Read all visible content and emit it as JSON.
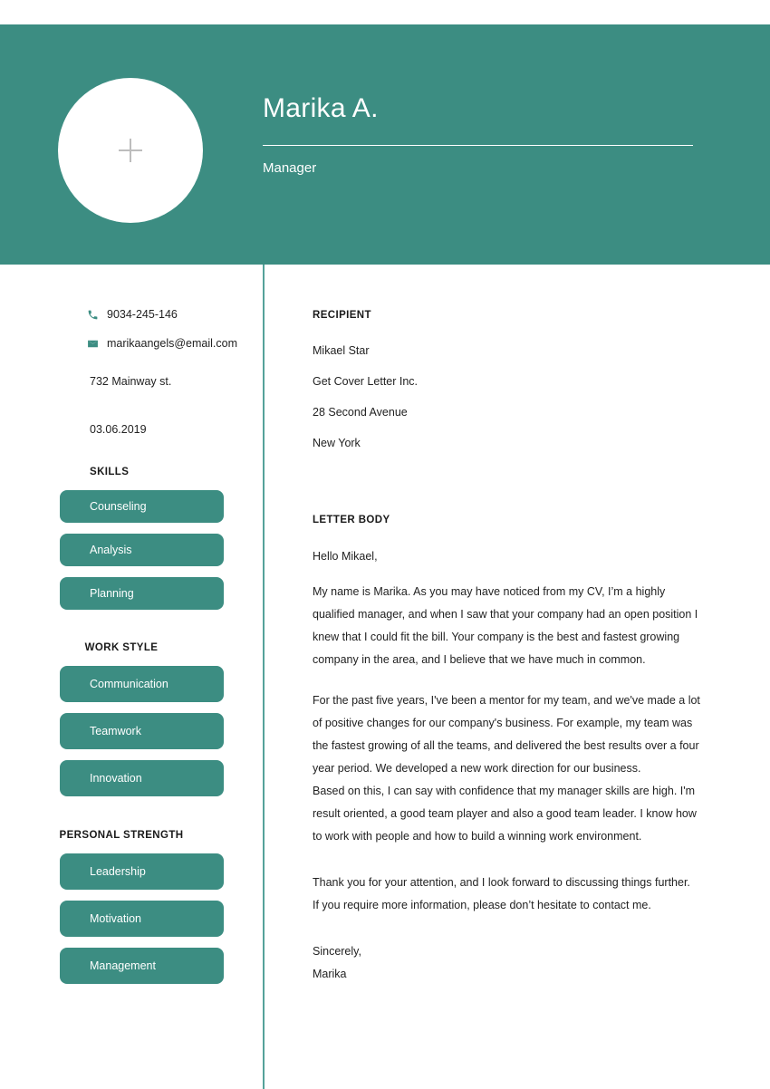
{
  "theme": {
    "accent": "#3c8d82",
    "divider": "#55a29a",
    "text": "#222222",
    "header_text": "#ffffff"
  },
  "header": {
    "name": "Marika A.",
    "job_title": "Manager",
    "avatar_placeholder_icon": "plus-icon"
  },
  "sidebar": {
    "contact": [
      {
        "icon": "phone-icon",
        "value": "9034-245-146"
      },
      {
        "icon": "envelope-icon",
        "value": "marikaangels@email.com"
      }
    ],
    "address": "732 Mainway st.",
    "date": "03.06.2019",
    "sections": [
      {
        "heading": "SKILLS",
        "align": "left",
        "items": [
          "Counseling",
          "Analysis",
          "Planning"
        ]
      },
      {
        "heading": "WORK STYLE",
        "align": "center",
        "items": [
          "Communication",
          "Teamwork",
          "Innovation"
        ]
      },
      {
        "heading": "PERSONAL STRENGTH",
        "align": "center",
        "items": [
          "Leadership",
          "Motivation",
          "Management"
        ]
      }
    ]
  },
  "letter": {
    "recipient_heading": "RECIPIENT",
    "recipient_lines": [
      "Mikael Star",
      "Get Cover Letter Inc.",
      "28 Second Avenue",
      "New York"
    ],
    "body_heading": "LETTER BODY",
    "salutation": "Hello Mikael,",
    "paragraphs": [
      "My name is Marika. As you may have noticed from my CV, I’m a highly qualified manager, and when I saw that your company had an open position I knew that I could fit the bill. Your company is the best and fastest growing company in the area, and I believe that we have much in common.",
      "For the past five years, I've been a mentor for my team, and we've made a lot of positive changes for our company's business. For example, my team was the fastest growing of all the teams, and delivered the best results over a four year period. We developed a new work direction for our business.",
      "Based on this, I can say with confidence that my manager skills are high. I'm result oriented, a good team player and also a good team leader. I know how to work with people and how to build a winning work environment."
    ],
    "closing": "Thank you for your attention, and I look forward to discussing things further.\nIf you require more information, please don’t hesitate to contact me.",
    "sign_off": "Sincerely,",
    "signature": "Marika"
  }
}
